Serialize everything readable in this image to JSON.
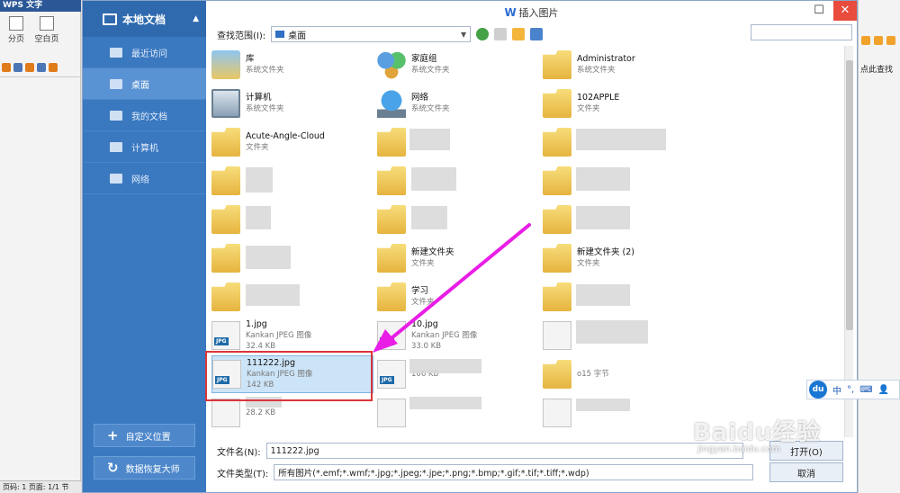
{
  "wps": {
    "title": "WPS 文字",
    "tools": [
      "分页",
      "空白页"
    ],
    "status": "页码: 1   页面: 1/1   节",
    "right_label": "点此查找"
  },
  "dialog": {
    "title": "插入图片",
    "min_icon": "minimize-icon",
    "close_icon": "close-icon"
  },
  "sidebar": {
    "header": "本地文档",
    "items": [
      {
        "label": "最近访问",
        "icon": "recent-icon"
      },
      {
        "label": "桌面",
        "icon": "desktop-icon",
        "active": true
      },
      {
        "label": "我的文档",
        "icon": "documents-icon"
      },
      {
        "label": "计算机",
        "icon": "computer-icon"
      },
      {
        "label": "网络",
        "icon": "network-icon"
      }
    ],
    "custom_button": "自定义位置",
    "recovery_button": "数据恢复大师"
  },
  "toolbar": {
    "look_in_label": "查找范围(I):",
    "look_in_value": "桌面"
  },
  "files": [
    {
      "name": "库",
      "type": "系统文件夹",
      "icon": "library-icon"
    },
    {
      "name": "家庭组",
      "type": "系统文件夹",
      "icon": "homegroup-icon"
    },
    {
      "name": "Administrator",
      "type": "系统文件夹",
      "icon": "folder-icon"
    },
    {
      "name": "计算机",
      "type": "系统文件夹",
      "icon": "computer-icon"
    },
    {
      "name": "网络",
      "type": "系统文件夹",
      "icon": "network-icon"
    },
    {
      "name": "102APPLE",
      "type": "文件夹",
      "icon": "folder-icon"
    },
    {
      "name": "Acute-Angle-Cloud",
      "type": "文件夹",
      "icon": "folder-icon"
    },
    {
      "name": "新建文件夹",
      "type": "文件夹",
      "icon": "folder-icon"
    },
    {
      "name": "新建文件夹 (2)",
      "type": "文件夹",
      "icon": "folder-icon"
    },
    {
      "name": "学习",
      "type": "文件夹",
      "icon": "folder-icon"
    },
    {
      "name": "1.jpg",
      "type": "Kankan JPEG 图像",
      "size": "32.4 KB",
      "icon": "jpg-icon"
    },
    {
      "name": "10.jpg",
      "type": "Kankan JPEG 图像",
      "size": "33.0 KB",
      "icon": "jpg-icon"
    },
    {
      "name": "111222.jpg",
      "type": "Kankan JPEG 图像",
      "size": "142 KB",
      "icon": "jpg-icon",
      "selected": true
    },
    {
      "name": "",
      "type": "",
      "size": "106 KB",
      "icon": "jpg-icon"
    },
    {
      "name": "o15 字节",
      "type": "",
      "icon": "folder-icon"
    },
    {
      "name": "",
      "type": "",
      "size": "28.2 KB",
      "icon": "jpg-icon"
    }
  ],
  "footer": {
    "filename_label": "文件名(N):",
    "filename_value": "111222.jpg",
    "filetype_label": "文件类型(T):",
    "filetype_value": "所有图片(*.emf;*.wmf;*.jpg;*.jpeg;*.jpe;*.png;*.bmp;*.gif;*.tif;*.tiff;*.wdp)",
    "open_button": "打开(O)",
    "cancel_button": "取消"
  },
  "ime": {
    "logo": "du",
    "mode": "中"
  },
  "watermark": {
    "brand": "Baidu经验",
    "url": "jingyan.baidu.com"
  },
  "arrow_color": "#e91ee6",
  "highlight_color": "#d9363a"
}
